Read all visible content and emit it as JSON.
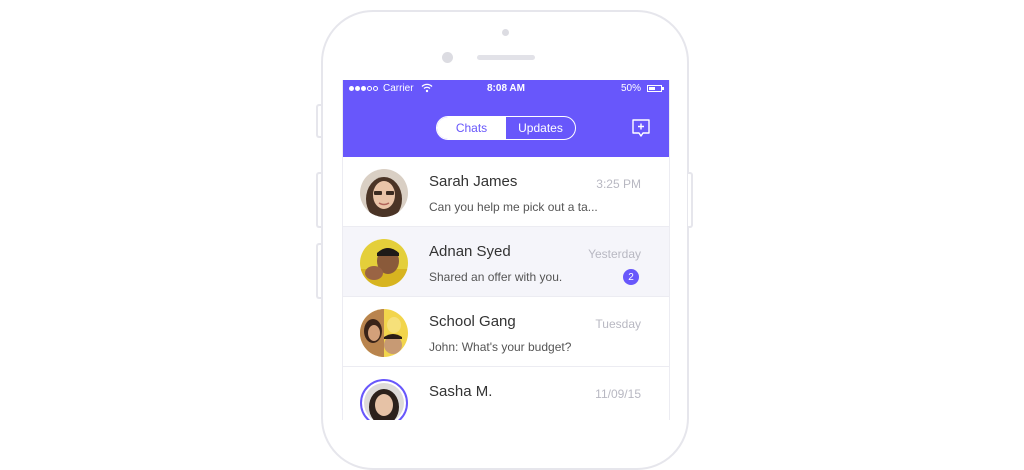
{
  "status_bar": {
    "carrier": "Carrier",
    "time": "8:08 AM",
    "battery_text": "50%",
    "battery_level": 0.5,
    "signal_bars_filled": 3,
    "signal_bars_total": 5
  },
  "header": {
    "tabs": [
      {
        "label": "Chats",
        "active": false
      },
      {
        "label": "Updates",
        "active": true
      }
    ],
    "compose_icon": "compose-message-icon",
    "accent_color": "#6857fb"
  },
  "chats": [
    {
      "name": "Sarah James",
      "time": "3:25 PM",
      "preview": "Can you help me pick out a ta...",
      "unread": null,
      "highlighted": false
    },
    {
      "name": "Adnan Syed",
      "time": "Yesterday",
      "preview": "Shared an offer with you.",
      "unread": "2",
      "highlighted": true
    },
    {
      "name": "School Gang",
      "time": "Tuesday",
      "preview": "John: What's your budget?",
      "unread": null,
      "highlighted": false
    },
    {
      "name": "Sasha M.",
      "time": "11/09/15",
      "preview": "",
      "unread": null,
      "highlighted": false
    }
  ]
}
